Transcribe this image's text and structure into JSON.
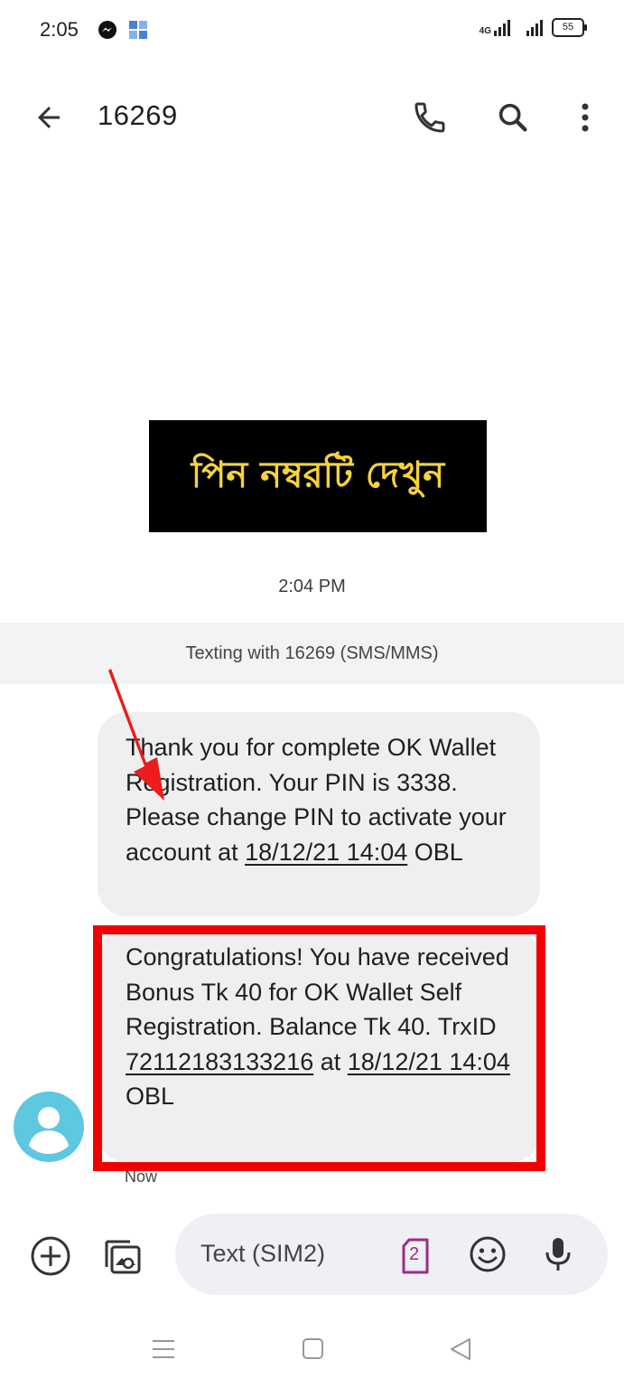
{
  "status_bar": {
    "time": "2:05",
    "network_label": "4G",
    "battery": "55"
  },
  "app_bar": {
    "title": "16269"
  },
  "conversation": {
    "image_text": "পিন নম্বরটি দেখুন",
    "timestamp": "2:04 PM",
    "info_text": "Texting with 16269 (SMS/MMS)",
    "message1": {
      "part1": "Thank you for complete OK Wallet Registration. Your PIN is 3338. Please change PIN to activate your account at ",
      "date": "18/12/21 14:04",
      "part2": " OBL"
    },
    "message2": {
      "part1": "Congratulations! You have received Bonus Tk 40 for OK Wallet Self Registration. Balance Tk 40. TrxID ",
      "trxid": "72112183133216",
      "at": " at ",
      "date": "18/12/21 14:04",
      "part2": " OBL"
    },
    "message2_time": "Now"
  },
  "compose": {
    "placeholder": "Text (SIM2)",
    "sim_badge": "2"
  },
  "colors": {
    "accent_red": "#f20000",
    "bubble_bg": "#efefef",
    "avatar_bg": "#5ec8e0",
    "sim_badge": "#9c2a8c",
    "image_text": "#f5d33b"
  },
  "icons": [
    "back-arrow-icon",
    "phone-icon",
    "search-icon",
    "more-vert-icon",
    "add-icon",
    "gallery-icon",
    "sim-icon",
    "emoji-icon",
    "mic-icon"
  ]
}
